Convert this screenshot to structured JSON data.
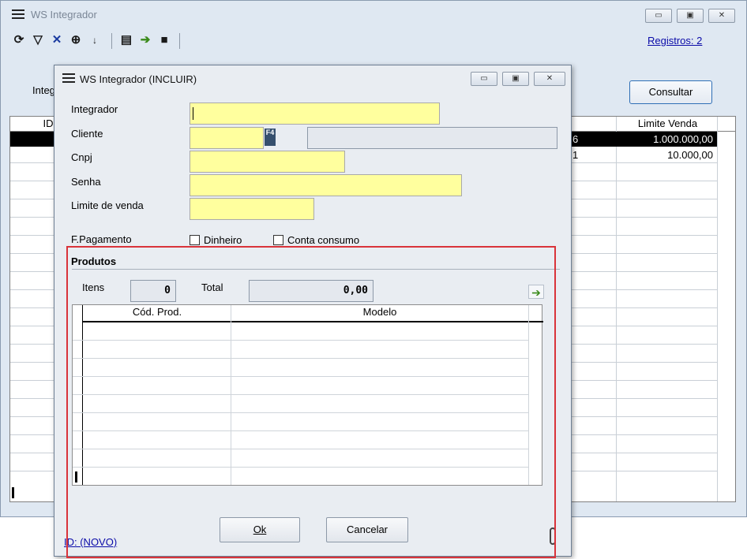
{
  "outer": {
    "title": "WS Integrador",
    "registros": "Registros: 2",
    "filter_label_partial": "Integ",
    "consultar": "Consultar",
    "caption": {
      "minimize": "▭",
      "restore": "▣",
      "close": "✕"
    },
    "toolbar_icons": [
      "refresh-icon",
      "filter-icon",
      "clear-filter-icon",
      "find-icon",
      "sort-icon",
      "print-icon",
      "export-icon",
      "save-icon"
    ],
    "grid": {
      "headers": {
        "id": "ID",
        "limite": "Limite Venda"
      },
      "rows": [
        {
          "partial": "6",
          "limite": "1.000.000,00",
          "selected": true
        },
        {
          "partial": "1",
          "limite": "10.000,00",
          "selected": false
        }
      ]
    }
  },
  "dialog": {
    "title": "WS Integrador (INCLUIR)",
    "caption": {
      "minimize": "▭",
      "restore": "▣",
      "close": "✕"
    },
    "fields": {
      "integrador": "Integrador",
      "cliente": "Cliente",
      "cliente_key": "F4",
      "cnpj": "Cnpj",
      "senha": "Senha",
      "limite": "Limite de venda"
    },
    "pagamento": {
      "label": "F.Pagamento",
      "dinheiro": "Dinheiro",
      "conta": "Conta consumo"
    },
    "produtos": {
      "title": "Produtos",
      "itens_label": "Itens",
      "itens_value": "0",
      "total_label": "Total",
      "total_value": "0,00",
      "columns": {
        "cod": "Cód. Prod.",
        "modelo": "Modelo"
      }
    },
    "ok": "Ok",
    "cancelar": "Cancelar",
    "id_link": "ID: (NOVO)"
  },
  "colors": {
    "highlight": "#d9333a",
    "input_yellow": "#ffff9e",
    "selected_row": "#000000"
  }
}
